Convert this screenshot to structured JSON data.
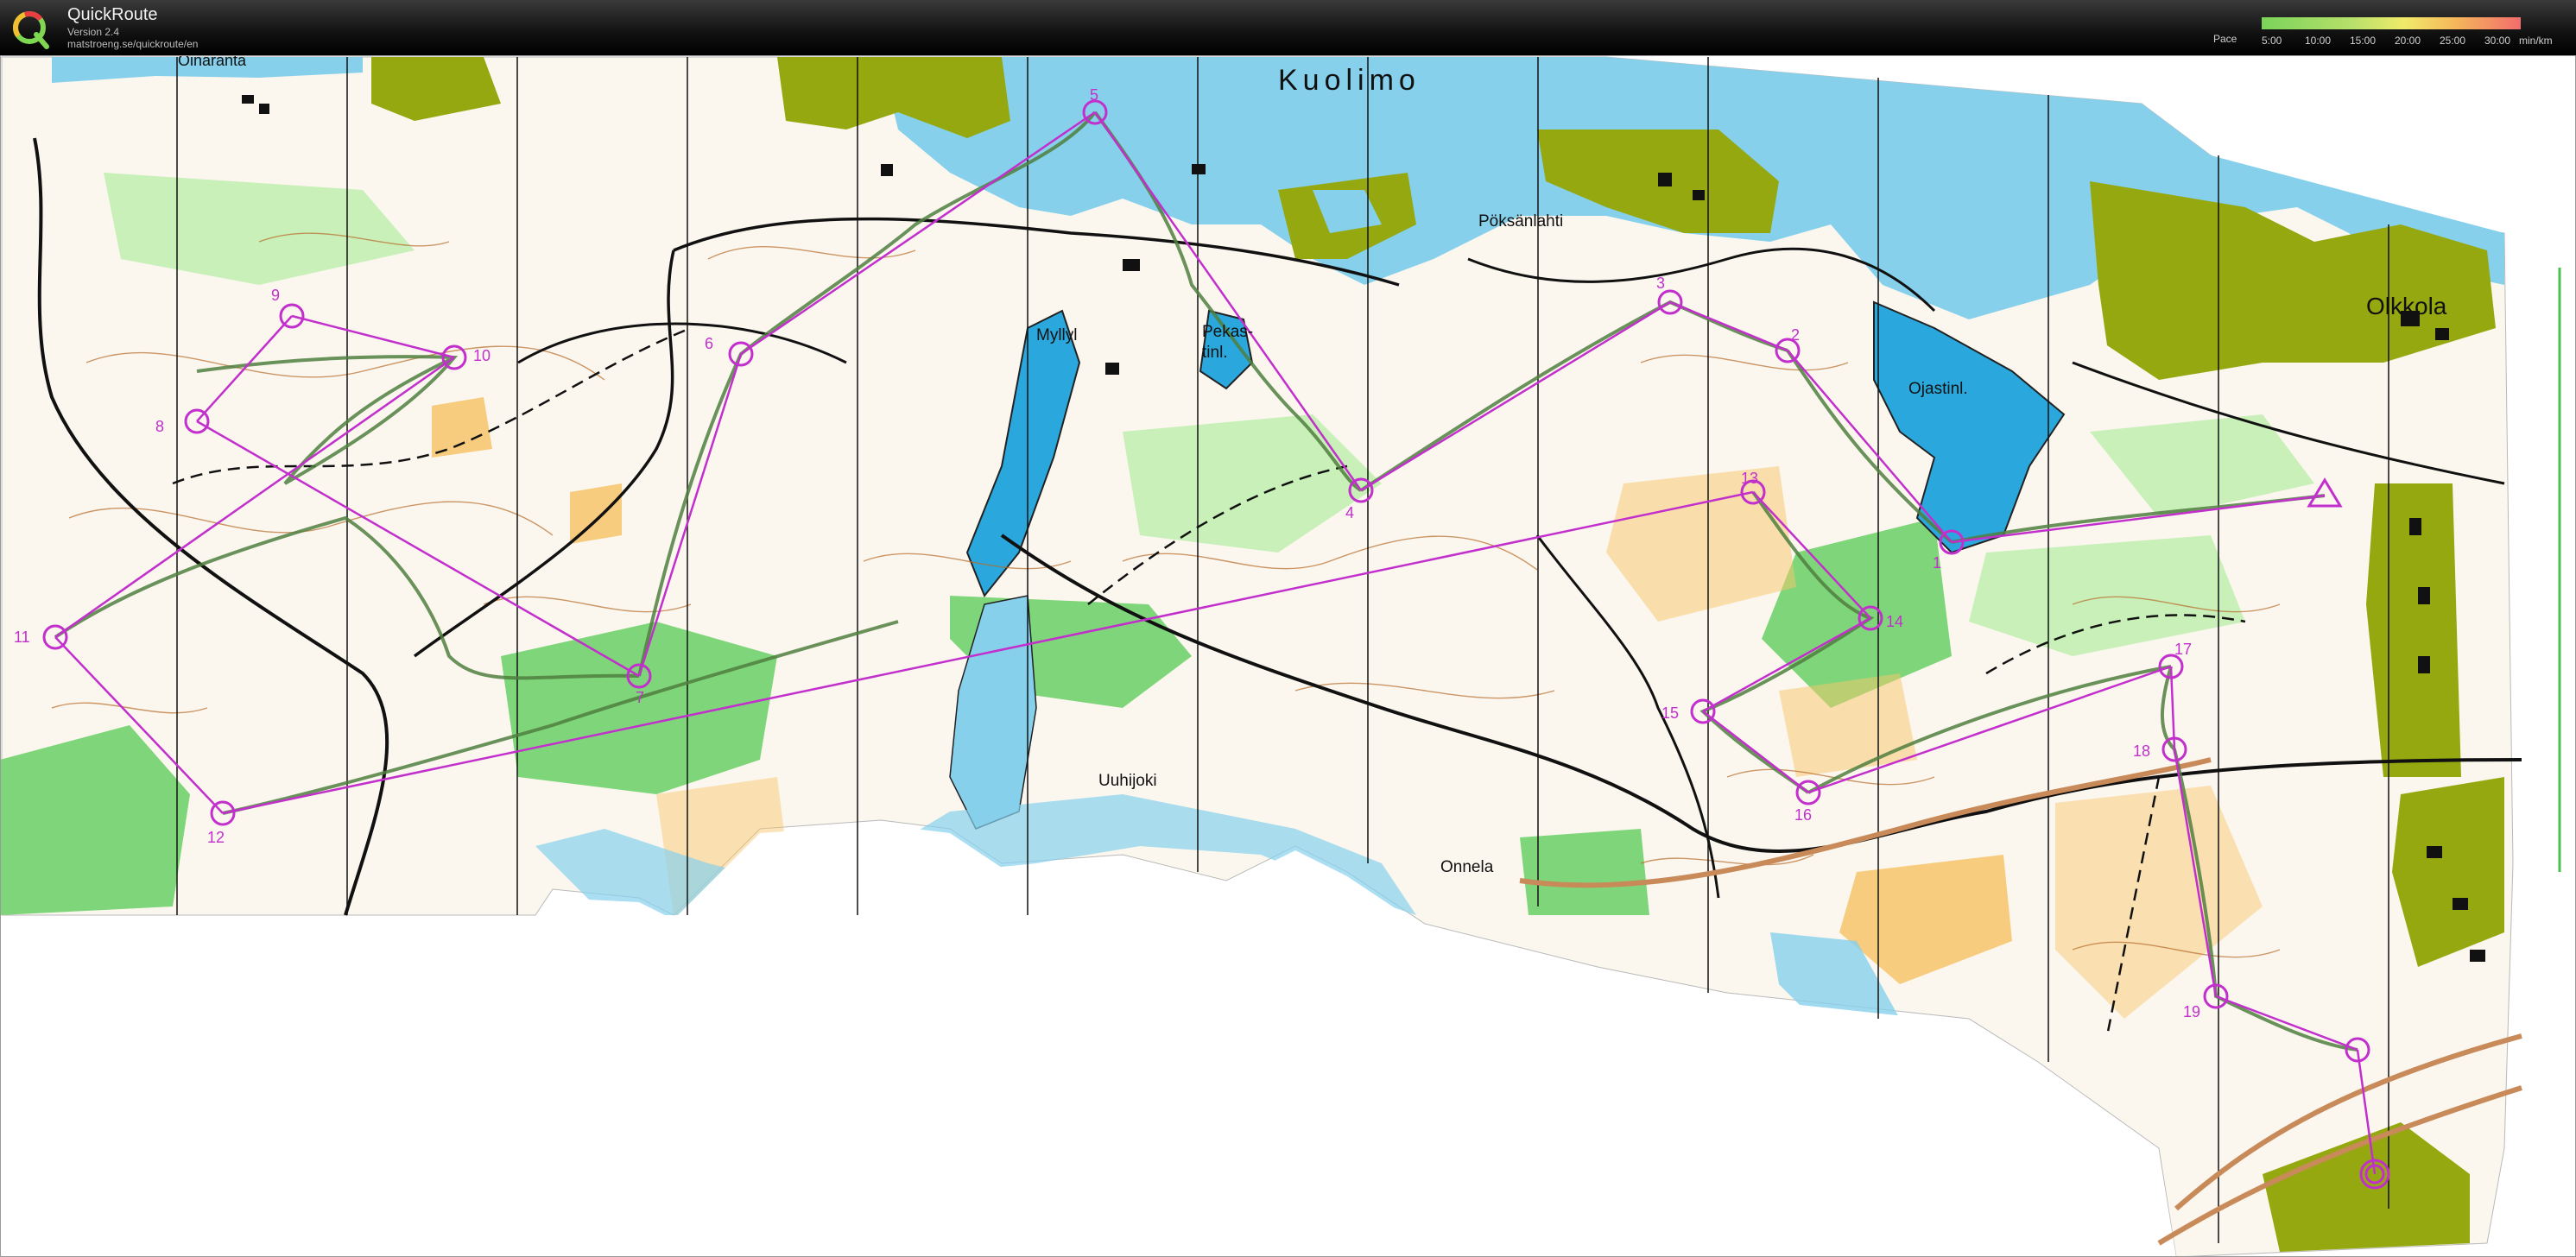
{
  "app": {
    "title": "QuickRoute",
    "version": "Version 2.4",
    "url": "matstroeng.se/quickroute/en"
  },
  "pace_legend": {
    "label": "Pace",
    "ticks": [
      "5:00",
      "10:00",
      "15:00",
      "20:00",
      "25:00",
      "30:00"
    ],
    "unit": "min/km"
  },
  "map_labels": {
    "kuolimo": "Kuolimo",
    "oinaranta": "Oinaranta",
    "poksanlahti": "Pöksänlahti",
    "myllyl": "Myllyl",
    "pekastinl": "Pekas-",
    "pekastinl2": "tinl.",
    "ojastinl": "Ojastinl.",
    "olkkola": "Olkkola",
    "uuhijoki": "Uuhijoki",
    "onnela": "Onnela"
  },
  "controls": [
    {
      "num": "1"
    },
    {
      "num": "2"
    },
    {
      "num": "3"
    },
    {
      "num": "4"
    },
    {
      "num": "5"
    },
    {
      "num": "6"
    },
    {
      "num": "7"
    },
    {
      "num": "8"
    },
    {
      "num": "9"
    },
    {
      "num": "10"
    },
    {
      "num": "11"
    },
    {
      "num": "12"
    },
    {
      "num": "13"
    },
    {
      "num": "14"
    },
    {
      "num": "15"
    },
    {
      "num": "16"
    },
    {
      "num": "17"
    },
    {
      "num": "18"
    },
    {
      "num": "19"
    }
  ],
  "colors": {
    "water": "#86d0ec",
    "lake_dark": "#2aa8dd",
    "forest_green": "#7fd67a",
    "light_green": "#c8f0b8",
    "olive": "#95a80f",
    "open_yellow": "#f7c46a",
    "course_purple": "#c22fcc",
    "contour_brown": "#b76b2a",
    "route": "#4f7f3f"
  }
}
